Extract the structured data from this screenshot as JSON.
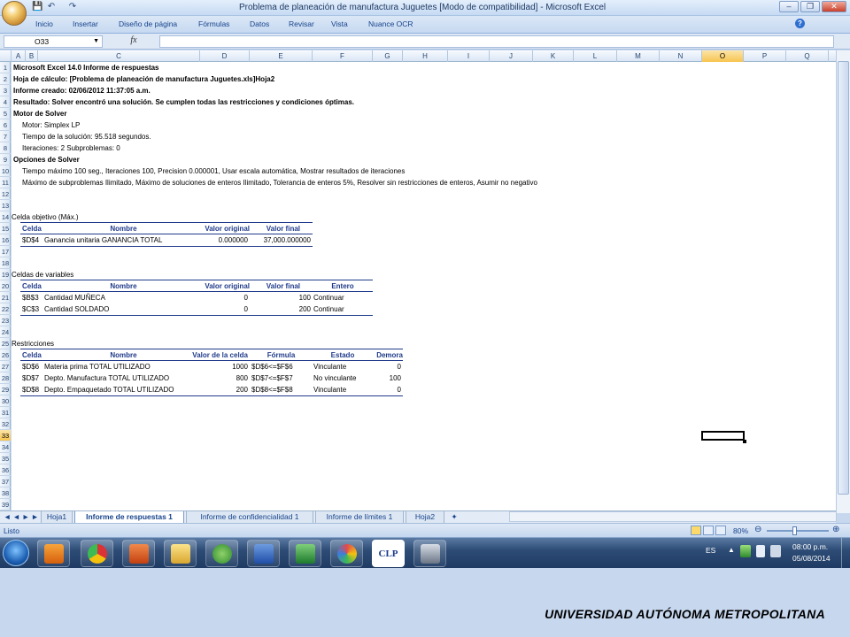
{
  "window": {
    "title": "Problema de planeación de manufactura Juguetes  [Modo de compatibilidad] - Microsoft Excel"
  },
  "ribbon": {
    "tabs": [
      "Inicio",
      "Insertar",
      "Diseño de página",
      "Fórmulas",
      "Datos",
      "Revisar",
      "Vista",
      "Nuance OCR"
    ]
  },
  "formula_bar": {
    "name_box": "O33",
    "fx": "fx",
    "value": ""
  },
  "columns": [
    "A",
    "B",
    "C",
    "D",
    "E",
    "F",
    "G",
    "H",
    "I",
    "J",
    "K",
    "L",
    "M",
    "N",
    "O",
    "P",
    "Q"
  ],
  "selected": {
    "column": "O",
    "row": "33"
  },
  "rows": [
    "1",
    "2",
    "3",
    "4",
    "5",
    "6",
    "7",
    "8",
    "9",
    "10",
    "11",
    "12",
    "13",
    "14",
    "15",
    "16",
    "17",
    "18",
    "19",
    "20",
    "21",
    "22",
    "23",
    "24",
    "25",
    "26",
    "27",
    "28",
    "29",
    "30",
    "31",
    "32",
    "33",
    "34",
    "35",
    "36",
    "37",
    "38",
    "39"
  ],
  "report": {
    "line1": "Microsoft Excel 14.0 Informe de respuestas",
    "line2": "Hoja de cálculo: [Problema de planeación de manufactura Juguetes.xls]Hoja2",
    "line3": "Informe creado: 02/06/2012 11:37:05 a.m.",
    "line4": "Resultado: Solver encontró una solución. Se cumplen todas las restricciones y condiciones óptimas.",
    "line5": "Motor de Solver",
    "line6": "Motor: Simplex LP",
    "line7": "Tiempo de la solución: 95.518 segundos.",
    "line8": "Iteraciones: 2 Subproblemas: 0",
    "line9": "Opciones de Solver",
    "line10": "Tiempo máximo 100 seg.,  Iteraciones 100, Precision 0.000001, Usar escala automática, Mostrar resultados de iteraciones",
    "line11": "Máximo de subproblemas Ilimitado, Máximo de soluciones de enteros Ilimitado, Tolerancia de enteros 5%, Resolver sin restricciones de enteros, Asumir no negativo"
  },
  "objective": {
    "title": "Celda objetivo (Máx.)",
    "headers": [
      "Celda",
      "Nombre",
      "Valor original",
      "Valor final"
    ],
    "rows": [
      [
        "$D$4",
        "Ganancia unitaria GANANCIA TOTAL",
        "0.000000",
        "37,000.000000"
      ]
    ]
  },
  "variables": {
    "title": "Celdas de variables",
    "headers": [
      "Celda",
      "Nombre",
      "Valor original",
      "Valor final",
      "Entero"
    ],
    "rows": [
      [
        "$B$3",
        "Cantidad MUÑECA",
        "0",
        "100",
        "Continuar"
      ],
      [
        "$C$3",
        "Cantidad SOLDADO",
        "0",
        "200",
        "Continuar"
      ]
    ]
  },
  "constraints": {
    "title": "Restricciones",
    "headers": [
      "Celda",
      "Nombre",
      "Valor de la celda",
      "Fórmula",
      "Estado",
      "Demora"
    ],
    "rows": [
      [
        "$D$6",
        "Materia prima TOTAL UTILIZADO",
        "1000",
        "$D$6<=$F$6",
        "Vinculante",
        "0"
      ],
      [
        "$D$7",
        "Depto. Manufactura TOTAL UTILIZADO",
        "800",
        "$D$7<=$F$7",
        "No vinculante",
        "100"
      ],
      [
        "$D$8",
        "Depto. Empaquetado TOTAL UTILIZADO",
        "200",
        "$D$8<=$F$8",
        "Vinculante",
        "0"
      ]
    ]
  },
  "sheet_tabs": [
    "Hoja1",
    "Informe de respuestas 1",
    "Informe de confidencialidad 1",
    "Informe de límites 1",
    "Hoja2"
  ],
  "active_sheet": "Informe de respuestas 1",
  "status": {
    "ready": "Listo",
    "zoom": "80%"
  },
  "taskbar": {
    "lang": "ES",
    "time": "08:00 p.m.",
    "date": "05/08/2014",
    "app_label": "CLP"
  },
  "footer": {
    "text": "UNIVERSIDAD AUTÓNOMA METROPOLITANA"
  },
  "icons": [
    "office-button-icon",
    "save-icon",
    "undo-icon",
    "redo-icon",
    "minimize-icon",
    "restore-icon",
    "close-icon",
    "help-icon",
    "windows-start-icon",
    "media-player-icon",
    "chrome-icon",
    "powerpoint-icon",
    "file-explorer-icon",
    "messenger-icon",
    "word-icon",
    "excel-icon",
    "paint-icon",
    "calculator-icon"
  ]
}
